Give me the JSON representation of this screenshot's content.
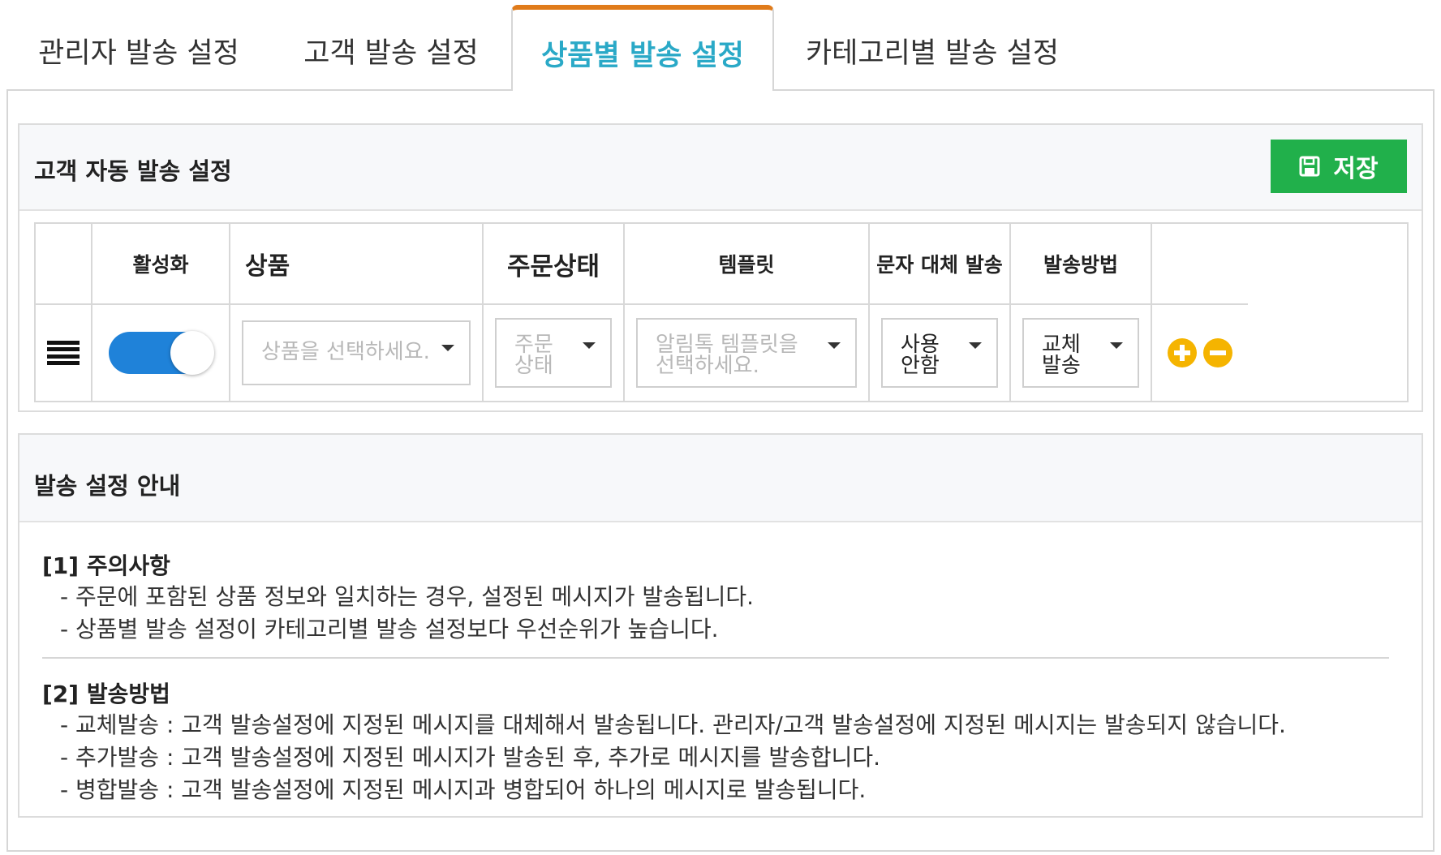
{
  "tabs": [
    {
      "label": "관리자 발송 설정",
      "active": false
    },
    {
      "label": "고객 발송 설정",
      "active": false
    },
    {
      "label": "상품별 발송 설정",
      "active": true
    },
    {
      "label": "카테고리별 발송 설정",
      "active": false
    }
  ],
  "colors": {
    "active_tab_text": "#2aa9c7",
    "active_tab_border": "#e07b1a",
    "save_button": "#21b04b",
    "toggle_on": "#1f82d9",
    "round_buttons": "#f5b400"
  },
  "settings_panel": {
    "title": "고객 자동 발송 설정",
    "save_label": "저장",
    "save_icon": "floppy-disk-icon",
    "columns": [
      "",
      "활성화",
      "상품",
      "주문상태",
      "템플릿",
      "문자 대체 발송",
      "발송방법",
      ""
    ],
    "row": {
      "enabled": true,
      "product_placeholder": "상품을 선택하세요.",
      "order_status_line1": "주문",
      "order_status_line2": "상태",
      "template_line1": "알림톡 템플릿을",
      "template_line2": "선택하세요.",
      "sms_fallback_line1": "사용",
      "sms_fallback_line2": "안함",
      "send_method_line1": "교체",
      "send_method_line2": "발송"
    }
  },
  "guide_panel": {
    "title": "발송 설정 안내",
    "sections": [
      {
        "title": "[1] 주의사항",
        "lines": [
          "- 주문에 포함된 상품 정보와 일치하는 경우, 설정된 메시지가 발송됩니다.",
          "- 상품별 발송 설정이 카테고리별 발송 설정보다 우선순위가 높습니다."
        ]
      },
      {
        "title": "[2] 발송방법",
        "lines": [
          "- 교체발송 : 고객 발송설정에 지정된 메시지를 대체해서 발송됩니다. 관리자/고객 발송설정에 지정된 메시지는 발송되지 않습니다.",
          "- 추가발송 : 고객 발송설정에 지정된 메시지가 발송된 후, 추가로 메시지를 발송합니다.",
          "- 병합발송 : 고객 발송설정에 지정된 메시지과 병합되어 하나의 메시지로 발송됩니다."
        ]
      }
    ]
  }
}
